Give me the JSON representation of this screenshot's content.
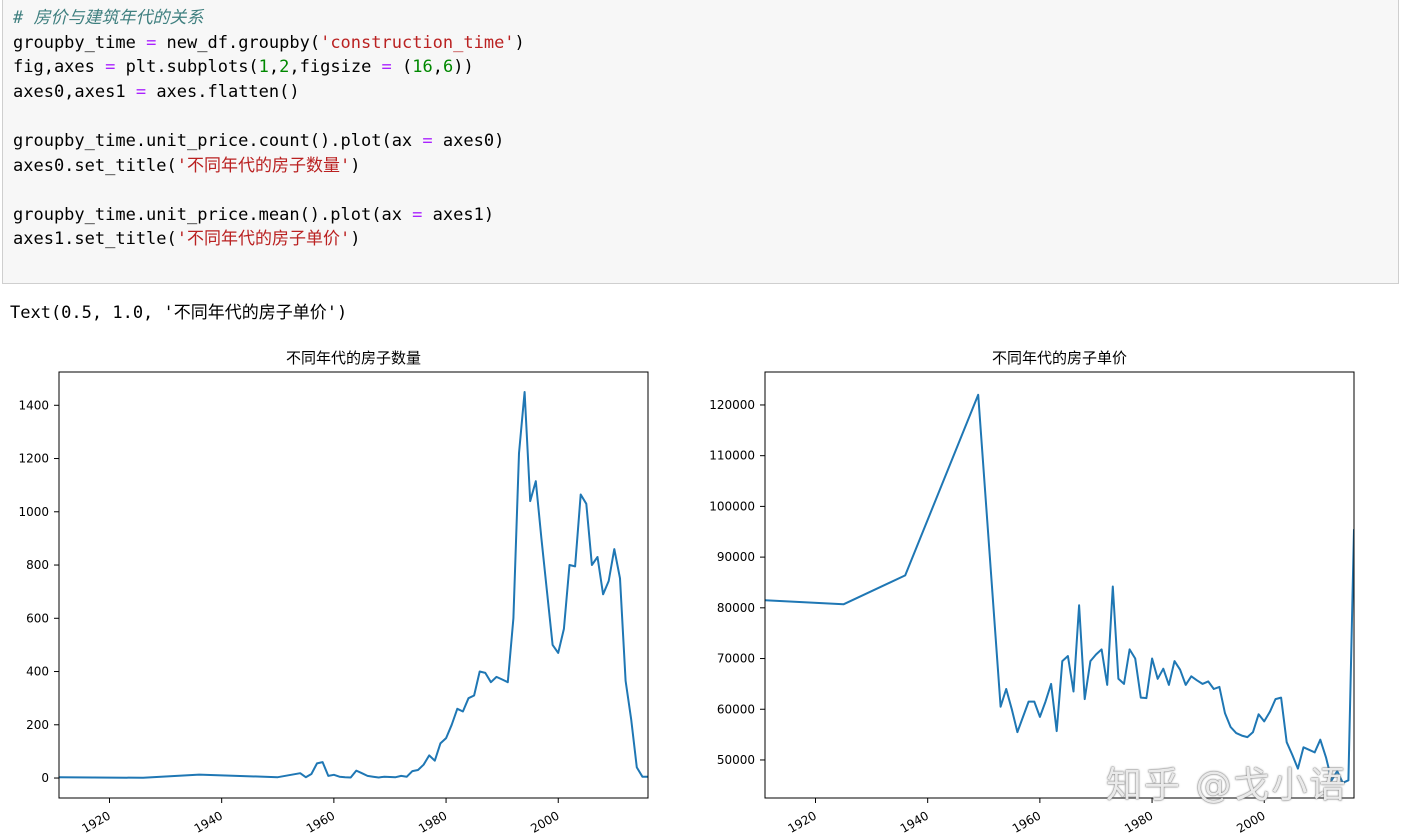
{
  "notebook": {
    "code_lines": [
      [
        {
          "t": "# 房价与建筑年代的关系",
          "c": "cm"
        }
      ],
      [
        {
          "t": "groupby_time "
        },
        {
          "t": "=",
          "c": "op"
        },
        {
          "t": " new_df.groupby("
        },
        {
          "t": "'construction_time'",
          "c": "str"
        },
        {
          "t": ")"
        }
      ],
      [
        {
          "t": "fig,axes "
        },
        {
          "t": "=",
          "c": "op"
        },
        {
          "t": " plt.subplots("
        },
        {
          "t": "1",
          "c": "num"
        },
        {
          "t": ","
        },
        {
          "t": "2",
          "c": "num"
        },
        {
          "t": ",figsize "
        },
        {
          "t": "=",
          "c": "op"
        },
        {
          "t": " ("
        },
        {
          "t": "16",
          "c": "num"
        },
        {
          "t": ","
        },
        {
          "t": "6",
          "c": "num"
        },
        {
          "t": "))"
        }
      ],
      [
        {
          "t": "axes0,axes1 "
        },
        {
          "t": "=",
          "c": "op"
        },
        {
          "t": " axes.flatten()"
        }
      ],
      [
        {
          "t": ""
        }
      ],
      [
        {
          "t": "groupby_time.unit_price.count().plot(ax "
        },
        {
          "t": "=",
          "c": "op"
        },
        {
          "t": " axes0)"
        }
      ],
      [
        {
          "t": "axes0.set_title("
        },
        {
          "t": "'不同年代的房子数量'",
          "c": "str"
        },
        {
          "t": ")"
        }
      ],
      [
        {
          "t": ""
        }
      ],
      [
        {
          "t": "groupby_time.unit_price.mean().plot(ax "
        },
        {
          "t": "=",
          "c": "op"
        },
        {
          "t": " axes1)"
        }
      ],
      [
        {
          "t": "axes1.set_title("
        },
        {
          "t": "'不同年代的房子单价'",
          "c": "str"
        },
        {
          "t": ")"
        }
      ]
    ],
    "output_text": "Text(0.5, 1.0, '不同年代的房子单价')"
  },
  "watermark": "知乎 @戈小语",
  "colors": {
    "line": "#1f77b4",
    "cell_bg": "#f7f7f7",
    "comment": "#408080",
    "operator": "#aa22ff",
    "number": "#008800",
    "string": "#ba2121"
  },
  "chart_data": [
    {
      "type": "line",
      "title": "不同年代的房子数量",
      "xlabel": "",
      "ylabel": "",
      "xlim": [
        1911,
        2016
      ],
      "ylim": [
        -75,
        1525
      ],
      "xticks": [
        1920,
        1940,
        1960,
        1980,
        2000
      ],
      "yticks": [
        0,
        200,
        400,
        600,
        800,
        1000,
        1200,
        1400
      ],
      "grid": false,
      "x": [
        1911,
        1926,
        1936,
        1950,
        1954,
        1955,
        1956,
        1957,
        1958,
        1959,
        1960,
        1961,
        1962,
        1963,
        1964,
        1965,
        1966,
        1967,
        1968,
        1969,
        1970,
        1971,
        1972,
        1973,
        1974,
        1975,
        1976,
        1977,
        1978,
        1979,
        1980,
        1981,
        1982,
        1983,
        1984,
        1985,
        1986,
        1987,
        1988,
        1989,
        1990,
        1991,
        1992,
        1993,
        1994,
        1995,
        1996,
        1997,
        1998,
        1999,
        2000,
        2001,
        2002,
        2003,
        2004,
        2005,
        2006,
        2007,
        2008,
        2009,
        2010,
        2011,
        2012,
        2013,
        2014,
        2015,
        2016
      ],
      "y": [
        3,
        1,
        13,
        3,
        18,
        3,
        15,
        55,
        60,
        8,
        12,
        5,
        3,
        2,
        28,
        18,
        8,
        5,
        2,
        5,
        4,
        3,
        8,
        5,
        26,
        30,
        50,
        85,
        65,
        130,
        150,
        200,
        260,
        250,
        300,
        310,
        400,
        395,
        360,
        380,
        370,
        360,
        600,
        1220,
        1450,
        1040,
        1115,
        900,
        700,
        500,
        470,
        560,
        800,
        795,
        1065,
        1030,
        800,
        830,
        690,
        740,
        860,
        750,
        365,
        220,
        40,
        5,
        5
      ]
    },
    {
      "type": "line",
      "title": "不同年代的房子单价",
      "xlabel": "",
      "ylabel": "",
      "xlim": [
        1911,
        2016
      ],
      "ylim": [
        42500,
        126500
      ],
      "xticks": [
        1920,
        1940,
        1960,
        1980,
        2000
      ],
      "yticks": [
        50000,
        60000,
        70000,
        80000,
        90000,
        100000,
        110000,
        120000
      ],
      "grid": false,
      "x": [
        1911,
        1925,
        1936,
        1949,
        1953,
        1954,
        1955,
        1956,
        1957,
        1958,
        1959,
        1960,
        1961,
        1962,
        1963,
        1964,
        1965,
        1966,
        1967,
        1968,
        1969,
        1970,
        1971,
        1972,
        1973,
        1974,
        1975,
        1976,
        1977,
        1978,
        1979,
        1980,
        1981,
        1982,
        1983,
        1984,
        1985,
        1986,
        1987,
        1988,
        1989,
        1990,
        1991,
        1992,
        1993,
        1994,
        1995,
        1996,
        1997,
        1998,
        1999,
        2000,
        2001,
        2002,
        2003,
        2004,
        2005,
        2006,
        2007,
        2008,
        2009,
        2010,
        2011,
        2012,
        2013,
        2014,
        2015,
        2016
      ],
      "y": [
        81500,
        80700,
        86400,
        122000,
        60500,
        64000,
        60000,
        55500,
        58500,
        61500,
        61500,
        58500,
        61500,
        65000,
        55700,
        69500,
        70500,
        63500,
        80500,
        62000,
        69500,
        70800,
        71800,
        64800,
        84200,
        66000,
        65000,
        71800,
        70000,
        62300,
        62200,
        70000,
        66000,
        68000,
        64800,
        69500,
        67800,
        64800,
        66500,
        65700,
        65000,
        65500,
        64000,
        64400,
        59200,
        56500,
        55300,
        54800,
        54500,
        55500,
        59000,
        57600,
        59500,
        62000,
        62300,
        53500,
        51000,
        48300,
        52500,
        52000,
        51500,
        54000,
        50500,
        46000,
        47800,
        45500,
        46000,
        95500
      ]
    }
  ]
}
